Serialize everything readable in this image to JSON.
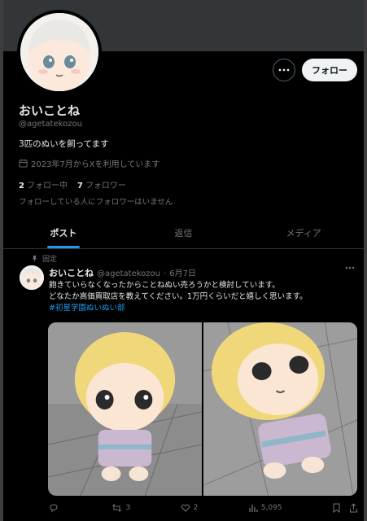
{
  "profile": {
    "display_name": "おいことね",
    "handle": "@agetatekozou",
    "bio": "3匹のぬいを飼ってます",
    "joined": "2023年7月からXを利用しています",
    "following_count": "2",
    "following_label": "フォロー中",
    "followers_count": "7",
    "followers_label": "フォロワー",
    "no_mutuals": "フォローしている人にフォロワーはいません",
    "follow_button": "フォロー",
    "more_icon": "more-horizontal-icon",
    "calendar_icon": "calendar-icon"
  },
  "tabs": [
    {
      "label": "ポスト",
      "active": true
    },
    {
      "label": "返信",
      "active": false
    },
    {
      "label": "メディア",
      "active": false
    }
  ],
  "post": {
    "pinned_label": "固定",
    "author": "おいことね",
    "handle": "@agetatekozou",
    "separator": "·",
    "date": "6月7日",
    "line1": "飽きていらなくなったからことねぬい売ろうかと検討しています。",
    "line2": "どなたか高価買取店を教えてください。1万円くらいだと嬉しく思います。",
    "hashtag": "#初星学園ぬいぬい部",
    "replies_count": "",
    "reposts_count": "3",
    "likes_count": "2",
    "views_count": "5,095"
  },
  "colors": {
    "accent": "#1d9bf0",
    "text": "#e7e9ea",
    "muted": "#71767b",
    "banner": "#333639"
  }
}
